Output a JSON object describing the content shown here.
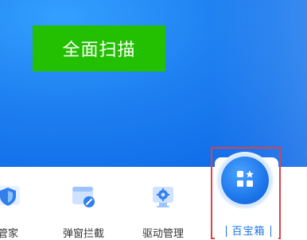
{
  "hero": {
    "scan_button_label": "全面扫描"
  },
  "tools": [
    {
      "label": "管家",
      "icon": "shield-icon"
    },
    {
      "label": "弹窗拦截",
      "icon": "popup-block-icon"
    },
    {
      "label": "驱动管理",
      "icon": "driver-settings-icon"
    }
  ],
  "toolbox": {
    "label": "百宝箱",
    "icon": "apps-grid-star-icon",
    "highlight_color": "#d9434a"
  },
  "colors": {
    "hero_blue": "#1e7ff0",
    "scan_green": "#22c000",
    "accent_blue": "#1a73e8"
  }
}
